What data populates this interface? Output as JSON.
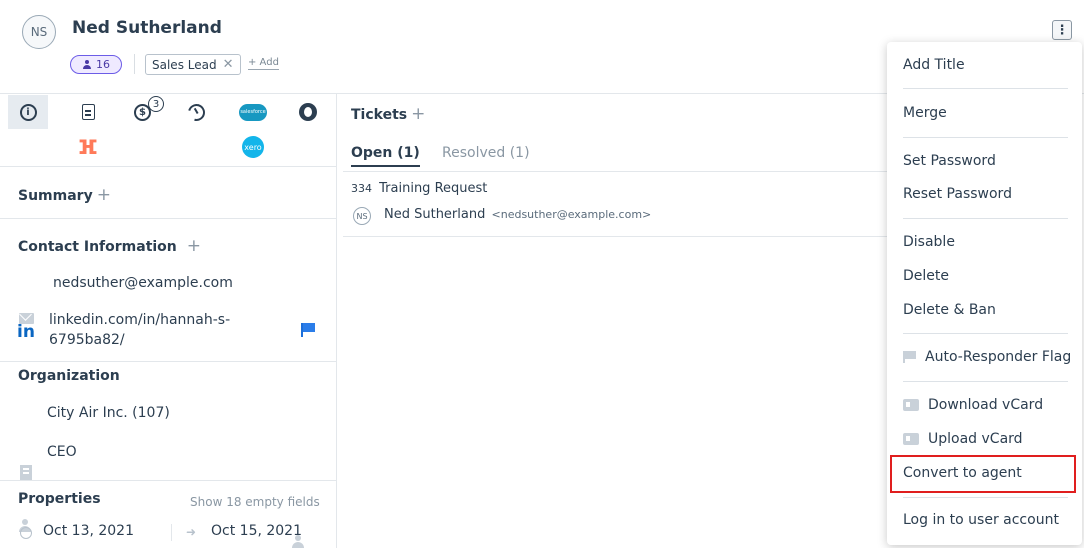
{
  "contact": {
    "initials": "NS",
    "name": "Ned Sutherland",
    "count": "16",
    "tag": "Sales Lead",
    "tag_remove": "✕",
    "add_tag": "+ Add"
  },
  "more_button": "⋮",
  "icon_tabs": {
    "info": "i",
    "deals": "$",
    "deals_badge": "3",
    "salesforce": "salesforce",
    "hubspot": "ⴼ",
    "xero": "xero"
  },
  "sidebar": {
    "summary_title": "Summary",
    "contact_info_title": "Contact Information",
    "plus": "+",
    "email": "nedsuther@example.com",
    "linkedin": "linkedin.com/in/hannah-s-6795ba82/",
    "linkedin_icon": "in",
    "organization_title": "Organization",
    "organization": "City Air Inc. (107)",
    "title": "CEO",
    "properties_title": "Properties",
    "show_empty": "Show 18 empty fields",
    "created_date": "Oct 13, 2021",
    "updated_date": "Oct 15, 2021"
  },
  "tickets": {
    "title": "Tickets",
    "plus": "+",
    "tabs": [
      {
        "label": "Open (1)"
      },
      {
        "label": "Resolved (1)"
      }
    ],
    "items": [
      {
        "number": "334",
        "subject": "Training Request",
        "requester_initials": "NS",
        "requester_name": "Ned Sutherland",
        "requester_email": "<nedsuther@example.com>"
      }
    ]
  },
  "menu": {
    "add_title": "Add Title",
    "merge": "Merge",
    "set_password": "Set Password",
    "reset_password": "Reset Password",
    "disable": "Disable",
    "delete": "Delete",
    "delete_ban": "Delete & Ban",
    "auto_responder_flag": "Auto-Responder Flag",
    "download_vcard": "Download vCard",
    "upload_vcard": "Upload vCard",
    "convert_to_agent": "Convert to agent",
    "log_in_as_user": "Log in to user account"
  },
  "colors": {
    "highlight": "#e01e1e",
    "accent_purple": "#6c5ce7",
    "link_blue": "#2b7de9"
  }
}
